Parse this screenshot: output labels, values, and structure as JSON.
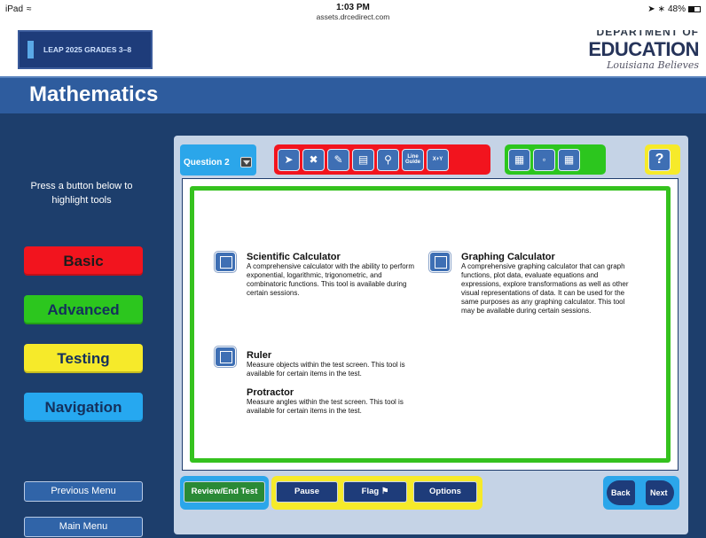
{
  "status": {
    "device": "iPad",
    "time": "1:03 PM",
    "url": "assets.drcedirect.com",
    "battery": "48%"
  },
  "brand": {
    "leap": "LEAP 2025 GRADES 3–8",
    "department": "DEPARTMENT OF",
    "education": "EDUCATION",
    "tagline": "Louisiana Believes"
  },
  "subject": "Mathematics",
  "sidebar": {
    "instruction": "Press a button below to highlight tools",
    "categories": [
      {
        "label": "Basic",
        "color": "#f2141e"
      },
      {
        "label": "Advanced",
        "color": "#2cc61e"
      },
      {
        "label": "Testing",
        "color": "#f6ea2a"
      },
      {
        "label": "Navigation",
        "color": "#26a8f0"
      }
    ],
    "menus": [
      "Previous Menu",
      "Main Menu"
    ]
  },
  "question": {
    "label": "Question 2"
  },
  "toolbar": {
    "basic_color": "#f2141e",
    "advanced_color": "#2cc61e",
    "testing_color": "#f6ea2a",
    "basic_tools": [
      "pointer-icon",
      "eliminator-icon",
      "highlighter-icon",
      "notepad-icon",
      "magnifier-icon",
      "line-guide-icon",
      "formula-icon"
    ],
    "line_guide": "Line Guide",
    "formula": "X+Y",
    "advanced_tools": [
      "calculator-icon",
      "ruler-protractor-icon",
      "graphing-calculator-icon"
    ],
    "help": "?"
  },
  "content": {
    "sci": {
      "title": "Scientific Calculator",
      "desc": "A comprehensive calculator with the ability to perform exponential, logarithmic, trigonometric, and combinatoric functions. This tool is available during certain sessions."
    },
    "graph": {
      "title": "Graphing Calculator",
      "desc": "A comprehensive graphing calculator that can graph functions, plot data, evaluate equations and expressions, explore transformations as well as other visual representations of data. It can be used for the same purposes as any graphing calculator.  This tool may be available during certain sessions."
    },
    "ruler": {
      "title": "Ruler",
      "desc": "Measure objects within the test screen. This tool is available for certain items in the test."
    },
    "protractor": {
      "title": "Protractor",
      "desc": "Measure angles within the test screen. This tool is available for certain items in the test."
    }
  },
  "bottom": {
    "review": "Review/End Test",
    "pause": "Pause",
    "flag": "Flag",
    "options": "Options",
    "back": "Back",
    "next": "Next"
  }
}
